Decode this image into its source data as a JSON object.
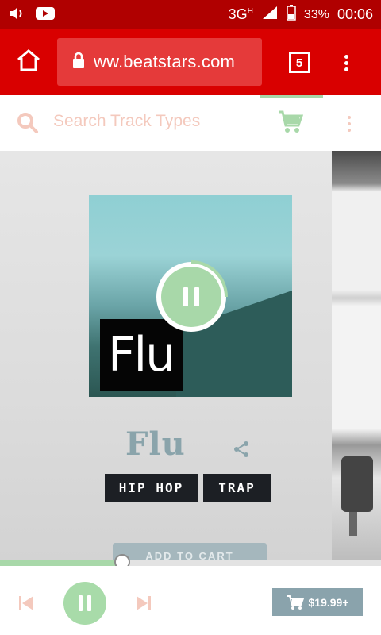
{
  "status_bar": {
    "network": "3G",
    "network_sup": "H",
    "battery": "33%",
    "time": "00:06",
    "icons": [
      "volume-icon",
      "youtube-icon",
      "signal-icon",
      "battery-icon"
    ]
  },
  "browser": {
    "url": "ww.beatstars.com",
    "tab_count": "5",
    "icons": [
      "home-icon",
      "lock-icon",
      "menu-dots-icon"
    ]
  },
  "header": {
    "search_placeholder": "Search Track Types",
    "icons": [
      "search-icon",
      "cart-icon",
      "kebab-icon"
    ]
  },
  "track": {
    "artwork_text": "Flu",
    "title": "Flu",
    "tags": [
      "HIP HOP",
      "TRAP"
    ],
    "add_to_cart_label": "ADD TO CART",
    "icons": [
      "pause-icon",
      "share-icon"
    ]
  },
  "player": {
    "progress": 0.32,
    "price": "$19.99+",
    "icons": [
      "previous-icon",
      "pause-icon",
      "next-icon",
      "cart-icon"
    ]
  },
  "colors": {
    "status_bar": "#b00000",
    "browser_bar": "#d90000",
    "accent_green": "#a8d8a9",
    "accent_salmon": "#f4c9bd",
    "title_gray_blue": "#8aa4ab",
    "tag_bg": "#1c1f24"
  }
}
